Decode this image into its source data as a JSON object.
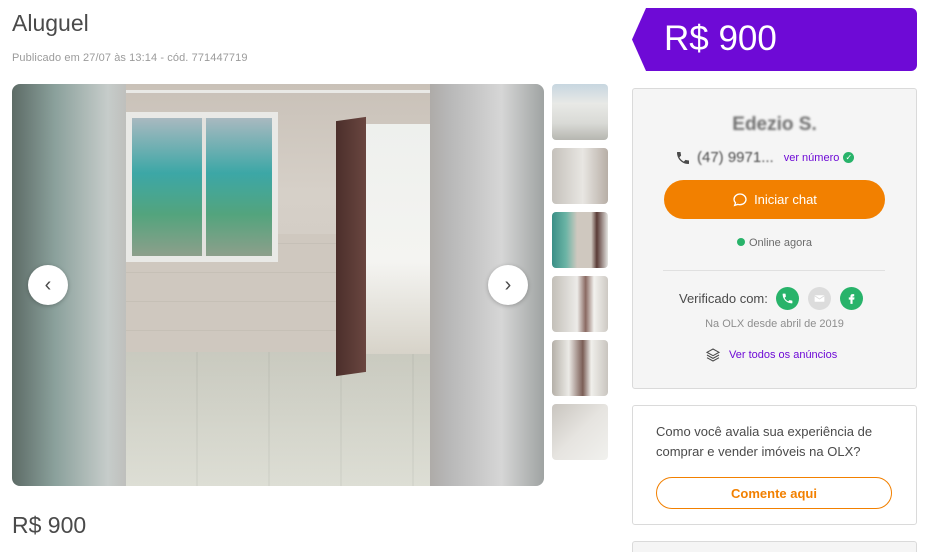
{
  "listing": {
    "title": "Aluguel",
    "meta": "Publicado em 27/07 às 13:14 - cód. 771447719",
    "bottom_price": "R$ 900"
  },
  "gallery": {
    "prev_label": "‹",
    "next_label": "›",
    "thumbnails": [
      "thumb-1",
      "thumb-2",
      "thumb-3",
      "thumb-4",
      "thumb-5",
      "thumb-6"
    ]
  },
  "price_tag": {
    "value": "R$ 900",
    "color": "#6e0ad6"
  },
  "seller": {
    "name": "Edezio S.",
    "phone": "(47) 9971...",
    "show_number_label": "ver número",
    "chat_button_label": "Iniciar chat",
    "online_status": "Online agora",
    "verified_label": "Verificado com:",
    "verified_icons": [
      "phone-icon",
      "mail-icon",
      "facebook-icon"
    ],
    "member_since": "Na OLX desde abril de 2019",
    "all_ads_label": "Ver todos os anúncios"
  },
  "feedback": {
    "question": "Como você avalia sua experiência de comprar e vender imóveis na OLX?",
    "button_label": "Comente aqui"
  },
  "colors": {
    "brand_purple": "#6e0ad6",
    "brand_orange": "#f28000",
    "online_green": "#28b36a"
  }
}
